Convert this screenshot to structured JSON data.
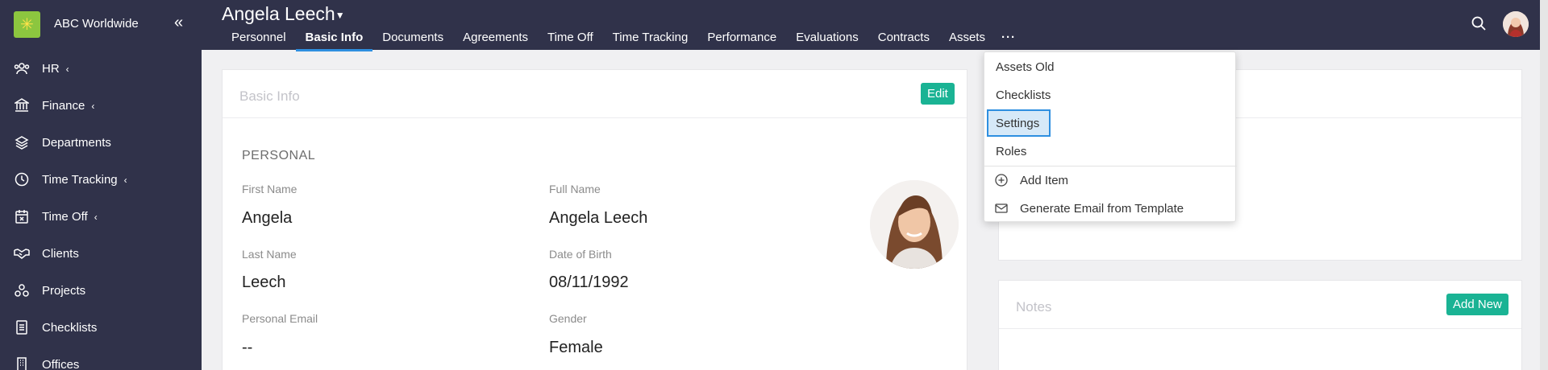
{
  "sidebar": {
    "brand": "ABC Worldwide",
    "items": [
      {
        "label": "HR",
        "icon": "users-icon",
        "caret": "‹"
      },
      {
        "label": "Finance",
        "icon": "bank-icon",
        "caret": "‹"
      },
      {
        "label": "Departments",
        "icon": "layers-icon",
        "caret": ""
      },
      {
        "label": "Time Tracking",
        "icon": "clock-icon",
        "caret": "‹"
      },
      {
        "label": "Time Off",
        "icon": "calendar-x-icon",
        "caret": "‹"
      },
      {
        "label": "Clients",
        "icon": "handshake-icon",
        "caret": ""
      },
      {
        "label": "Projects",
        "icon": "projects-icon",
        "caret": ""
      },
      {
        "label": "Checklists",
        "icon": "checklist-icon",
        "caret": ""
      },
      {
        "label": "Offices",
        "icon": "building-icon",
        "caret": ""
      }
    ]
  },
  "header": {
    "person_name": "Angela Leech",
    "tabs": [
      {
        "label": "Personnel",
        "active": false
      },
      {
        "label": "Basic Info",
        "active": true
      },
      {
        "label": "Documents",
        "active": false
      },
      {
        "label": "Agreements",
        "active": false
      },
      {
        "label": "Time Off",
        "active": false
      },
      {
        "label": "Time Tracking",
        "active": false
      },
      {
        "label": "Performance",
        "active": false
      },
      {
        "label": "Evaluations",
        "active": false
      },
      {
        "label": "Contracts",
        "active": false
      },
      {
        "label": "Assets",
        "active": false
      }
    ],
    "more_label": "···"
  },
  "basic_info": {
    "title": "Basic Info",
    "edit_label": "Edit",
    "section": "PERSONAL",
    "fields": {
      "first_name_label": "First Name",
      "first_name": "Angela",
      "full_name_label": "Full Name",
      "full_name": "Angela Leech",
      "last_name_label": "Last Name",
      "last_name": "Leech",
      "dob_label": "Date of Birth",
      "dob": "08/11/1992",
      "email_label": "Personal Email",
      "email": "--",
      "gender_label": "Gender",
      "gender": "Female"
    }
  },
  "notes": {
    "title": "Notes",
    "add_label": "Add New"
  },
  "dropdown": {
    "items": [
      "Assets Old",
      "Checklists",
      "Settings",
      "Roles"
    ],
    "selected": "Settings",
    "actions": [
      {
        "label": "Add Item",
        "icon": "plus-circle-icon"
      },
      {
        "label": "Generate Email from Template",
        "icon": "envelope-icon"
      }
    ]
  },
  "colors": {
    "sidebar_bg": "#30324a",
    "accent_green": "#1ab394",
    "accent_blue": "#2e8fe0"
  }
}
